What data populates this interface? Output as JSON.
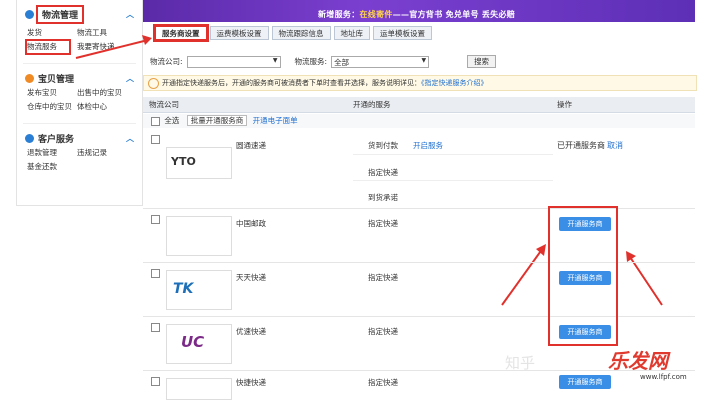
{
  "sidebar": {
    "sections": [
      {
        "title": "物流管理",
        "color": "#2a7fd4",
        "links": [
          "发货",
          "物流工具",
          "物流服务",
          "我要寄快递"
        ]
      },
      {
        "title": "宝贝管理",
        "color": "#f08a24",
        "links": [
          "发布宝贝",
          "出售中的宝贝",
          "仓库中的宝贝",
          "体检中心"
        ]
      },
      {
        "title": "客户服务",
        "color": "#2a7fd4",
        "links": [
          "退款管理",
          "违规记录",
          "基金还款"
        ]
      }
    ]
  },
  "banner": {
    "prefix": "新增服务：",
    "highlight": "在线寄件",
    "suffix": "——官方背书 免兑单号 丢失必赔"
  },
  "tabs": [
    "服务商设置",
    "运费模板设置",
    "物流跟踪信息",
    "地址库",
    "运单模板设置"
  ],
  "search": {
    "company_label": "物流公司:",
    "service_label": "物流服务:",
    "service_value": "全部",
    "button": "搜索"
  },
  "tip": {
    "text": "开通指定快递服务后，开通的服务商可被消费者下单时查看并选择，服务说明详见：",
    "link": "《指定快递服务介绍》"
  },
  "table": {
    "headers": [
      "物流公司",
      "开通的服务",
      "操作"
    ],
    "select_all": "全选",
    "batch_button": "批量开通服务商",
    "open_label_link": "开通电子面单",
    "rows": [
      {
        "name": "圆通速递",
        "logo": "YTO",
        "logo_color": "#6b2d8c",
        "services": [
          "货到付款",
          "指定快递",
          "到货承诺"
        ],
        "service_link": "开启服务",
        "status": "已开通服务商",
        "action_link": "取消"
      },
      {
        "name": "中国邮政",
        "logo": "",
        "logo_color": "#cccccc",
        "services": [
          "指定快递"
        ],
        "button": "开通服务商"
      },
      {
        "name": "天天快递",
        "logo": "TK",
        "logo_color": "#1c6fb8",
        "services": [
          "指定快递"
        ],
        "button": "开通服务商"
      },
      {
        "name": "优速快递",
        "logo": "UC",
        "logo_color": "#7b2a88",
        "services": [
          "指定快递"
        ],
        "button": "开通服务商"
      },
      {
        "name": "快捷快递",
        "logo": "",
        "logo_color": "#cccccc",
        "services": [
          "指定快递"
        ],
        "button": "开通服务商"
      }
    ]
  },
  "watermark": {
    "zhihu": "知乎",
    "site_name": "乐发网",
    "site_url": "www.lfpf.com"
  }
}
